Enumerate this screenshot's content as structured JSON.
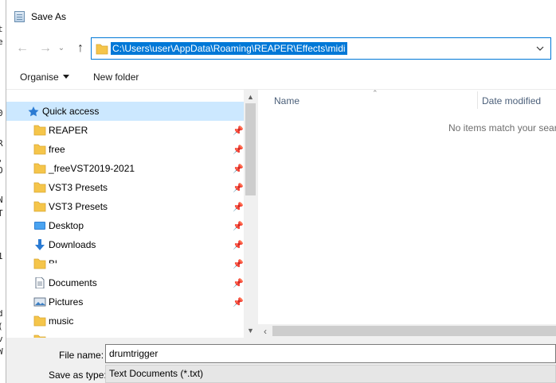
{
  "background_chars": [
    "t",
    "e",
    "0",
    "R",
    ",",
    "O",
    "N",
    "T",
    "1",
    "d",
    "(",
    "v",
    "W"
  ],
  "dialog": {
    "title": "Save As",
    "address": {
      "path": "C:\\Users\\user\\AppData\\Roaming\\REAPER\\Effects\\midi"
    },
    "toolbar": {
      "organise_label": "Organise",
      "new_folder_label": "New folder"
    },
    "nav": {
      "quick_access": "Quick access",
      "items": [
        {
          "label": "REAPER",
          "icon": "folder-icon",
          "pinned": true
        },
        {
          "label": "free",
          "icon": "folder-icon",
          "pinned": true
        },
        {
          "label": "_freeVST2019-2021",
          "icon": "folder-icon",
          "pinned": true
        },
        {
          "label": "VST3 Presets",
          "icon": "folder-icon",
          "pinned": true
        },
        {
          "label": "VST3 Presets",
          "icon": "folder-icon",
          "pinned": true
        },
        {
          "label": "Desktop",
          "icon": "desktop-icon",
          "pinned": true
        },
        {
          "label": "Downloads",
          "icon": "download-icon",
          "pinned": true
        },
        {
          "label": "Bl..",
          "icon": "folder-icon",
          "pinned": true
        },
        {
          "label": "Documents",
          "icon": "documents-icon",
          "pinned": true
        },
        {
          "label": "Pictures",
          "icon": "pictures-icon",
          "pinned": true
        },
        {
          "label": "music",
          "icon": "folder-icon",
          "pinned": false
        }
      ]
    },
    "filelist": {
      "col_name": "Name",
      "col_date": "Date modified",
      "empty_message": "No items match your search."
    },
    "filename_label": "File name:",
    "filename_value": "drumtrigger",
    "saveas_label": "Save as type:",
    "saveas_value": "Text Documents (*.txt)"
  }
}
